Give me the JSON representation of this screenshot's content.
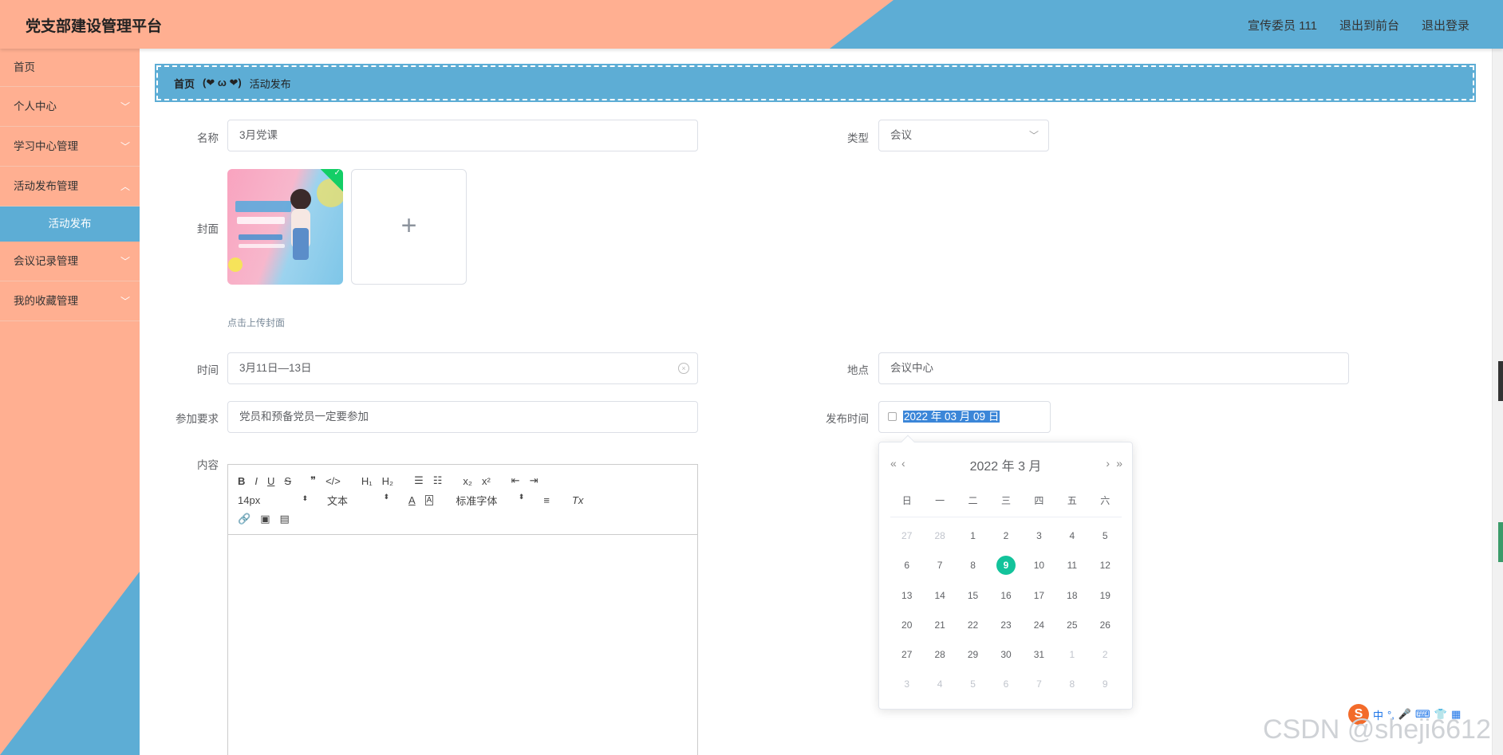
{
  "header": {
    "brand": "党支部建设管理平台",
    "user": "宣传委员 111",
    "to_front": "退出到前台",
    "logout": "退出登录"
  },
  "sidebar": {
    "items": [
      {
        "label": "首页"
      },
      {
        "label": "个人中心"
      },
      {
        "label": "学习中心管理"
      },
      {
        "label": "活动发布管理"
      },
      {
        "label": "会议记录管理"
      },
      {
        "label": "我的收藏管理"
      }
    ],
    "active_sub": "活动发布"
  },
  "breadcrumb": {
    "home": "首页",
    "separator": "(❤ ω ❤)",
    "current": "活动发布"
  },
  "form": {
    "name_label": "名称",
    "name_value": "3月党课",
    "type_label": "类型",
    "type_value": "会议",
    "cover_label": "封面",
    "cover_hint": "点击上传封面",
    "time_label": "时间",
    "time_value": "3月11日—13日",
    "place_label": "地点",
    "place_value": "会议中心",
    "req_label": "参加要求",
    "req_value": "党员和预备党员一定要参加",
    "pub_label": "发布时间",
    "pub_value": "2022 年 03 月 09 日",
    "content_label": "内容"
  },
  "editor": {
    "font_size": "14px",
    "block_type": "文本",
    "font_family": "标准字体"
  },
  "datepicker": {
    "header": "2022 年  3 月",
    "weekdays": [
      "日",
      "一",
      "二",
      "三",
      "四",
      "五",
      "六"
    ],
    "days": [
      [
        "27",
        "28",
        "1",
        "2",
        "3",
        "4",
        "5"
      ],
      [
        "6",
        "7",
        "8",
        "9",
        "10",
        "11",
        "12"
      ],
      [
        "13",
        "14",
        "15",
        "16",
        "17",
        "18",
        "19"
      ],
      [
        "20",
        "21",
        "22",
        "23",
        "24",
        "25",
        "26"
      ],
      [
        "27",
        "28",
        "29",
        "30",
        "31",
        "1",
        "2"
      ],
      [
        "3",
        "4",
        "5",
        "6",
        "7",
        "8",
        "9"
      ]
    ],
    "selected": "9",
    "accent": "#13c39b"
  },
  "watermark": "CSDN @sheji6612",
  "colors": {
    "peach": "#ffaf91",
    "blue": "#5dadd5"
  }
}
